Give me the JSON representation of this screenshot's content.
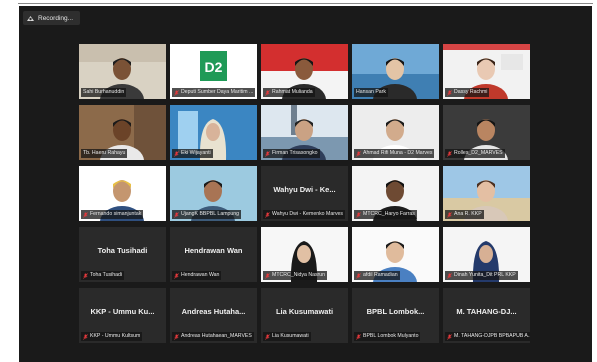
{
  "recording": {
    "label": "Recording..."
  },
  "accent": "#c8d341",
  "mute_color": "#e5393c",
  "participants": [
    {
      "name": "Sahi Burhanuddin",
      "center_name": "",
      "muted": false,
      "video": "man-tan",
      "active": false
    },
    {
      "name": "Deputi Sumber Daya Maritim ...",
      "center_name": "",
      "muted": true,
      "video": "d2-logo",
      "active": false
    },
    {
      "name": "Rahmat Mulianda",
      "center_name": "",
      "muted": true,
      "video": "man-flag",
      "active": false
    },
    {
      "name": "Hansan Park",
      "center_name": "",
      "muted": false,
      "video": "man-glasses",
      "active": false
    },
    {
      "name": "Dassy Rachmi",
      "center_name": "",
      "muted": true,
      "video": "woman-red",
      "active": false
    },
    {
      "name": "Tb. Haeru Rahayu",
      "center_name": "",
      "muted": false,
      "video": "man-brown",
      "active": true
    },
    {
      "name": "Eki Wijayanti",
      "center_name": "",
      "muted": true,
      "video": "woman-hijab-window",
      "active": false
    },
    {
      "name": "Firman Trisasongko",
      "center_name": "",
      "muted": true,
      "video": "man-tower",
      "active": false
    },
    {
      "name": "Ahmad Rifi Muna - D2 Marves",
      "center_name": "",
      "muted": true,
      "video": "man-white",
      "active": false
    },
    {
      "name": "Rolles_D2_MARVES",
      "center_name": "",
      "muted": true,
      "video": "man-mask",
      "active": false
    },
    {
      "name": "Fernando simanjuntak",
      "center_name": "",
      "muted": true,
      "video": "man-cap",
      "active": false
    },
    {
      "name": "UjangK BBPBL Lampung",
      "center_name": "",
      "muted": true,
      "video": "man-uniform",
      "active": false
    },
    {
      "name": "Wahyu Dwi - Kemenko Marves",
      "center_name": "Wahyu Dwi - Ke...",
      "muted": true,
      "video": "",
      "active": false
    },
    {
      "name": "MTCRC_Haryo Farras",
      "center_name": "",
      "muted": true,
      "video": "man-dark",
      "active": false
    },
    {
      "name": "Ana R. KKP",
      "center_name": "",
      "muted": true,
      "video": "woman-beach",
      "active": false
    },
    {
      "name": "Toha Tusihadi",
      "center_name": "Toha Tusihadi",
      "muted": true,
      "video": "",
      "active": false
    },
    {
      "name": "Hendrawan Wan",
      "center_name": "Hendrawan Wan",
      "muted": true,
      "video": "",
      "active": false
    },
    {
      "name": "MTCRC_Nidya Nasrun",
      "center_name": "",
      "muted": true,
      "video": "woman-hijab-black",
      "active": false
    },
    {
      "name": "afdil Ramadian",
      "center_name": "",
      "muted": true,
      "video": "man-blue",
      "active": false
    },
    {
      "name": "Dinah Yunita_Dit PRL KKP",
      "center_name": "",
      "muted": true,
      "video": "woman-hijab-navy",
      "active": false
    },
    {
      "name": "KKP - Ummu Kultsum",
      "center_name": "KKP - Ummu Ku...",
      "muted": true,
      "video": "",
      "active": false
    },
    {
      "name": "Andreas Hutahaean_MARVES",
      "center_name": "Andreas Hutaha...",
      "muted": true,
      "video": "",
      "active": false
    },
    {
      "name": "Lia Kusumawati",
      "center_name": "Lia Kusumawati",
      "muted": true,
      "video": "",
      "active": false
    },
    {
      "name": "BPBL Lombok Mulyanto",
      "center_name": "BPBL Lombok...",
      "muted": true,
      "video": "",
      "active": false
    },
    {
      "name": "M. TAHANG-DJPB BPBAPUB A...",
      "center_name": "M. TAHANG-DJ...",
      "muted": true,
      "video": "",
      "active": false
    }
  ]
}
